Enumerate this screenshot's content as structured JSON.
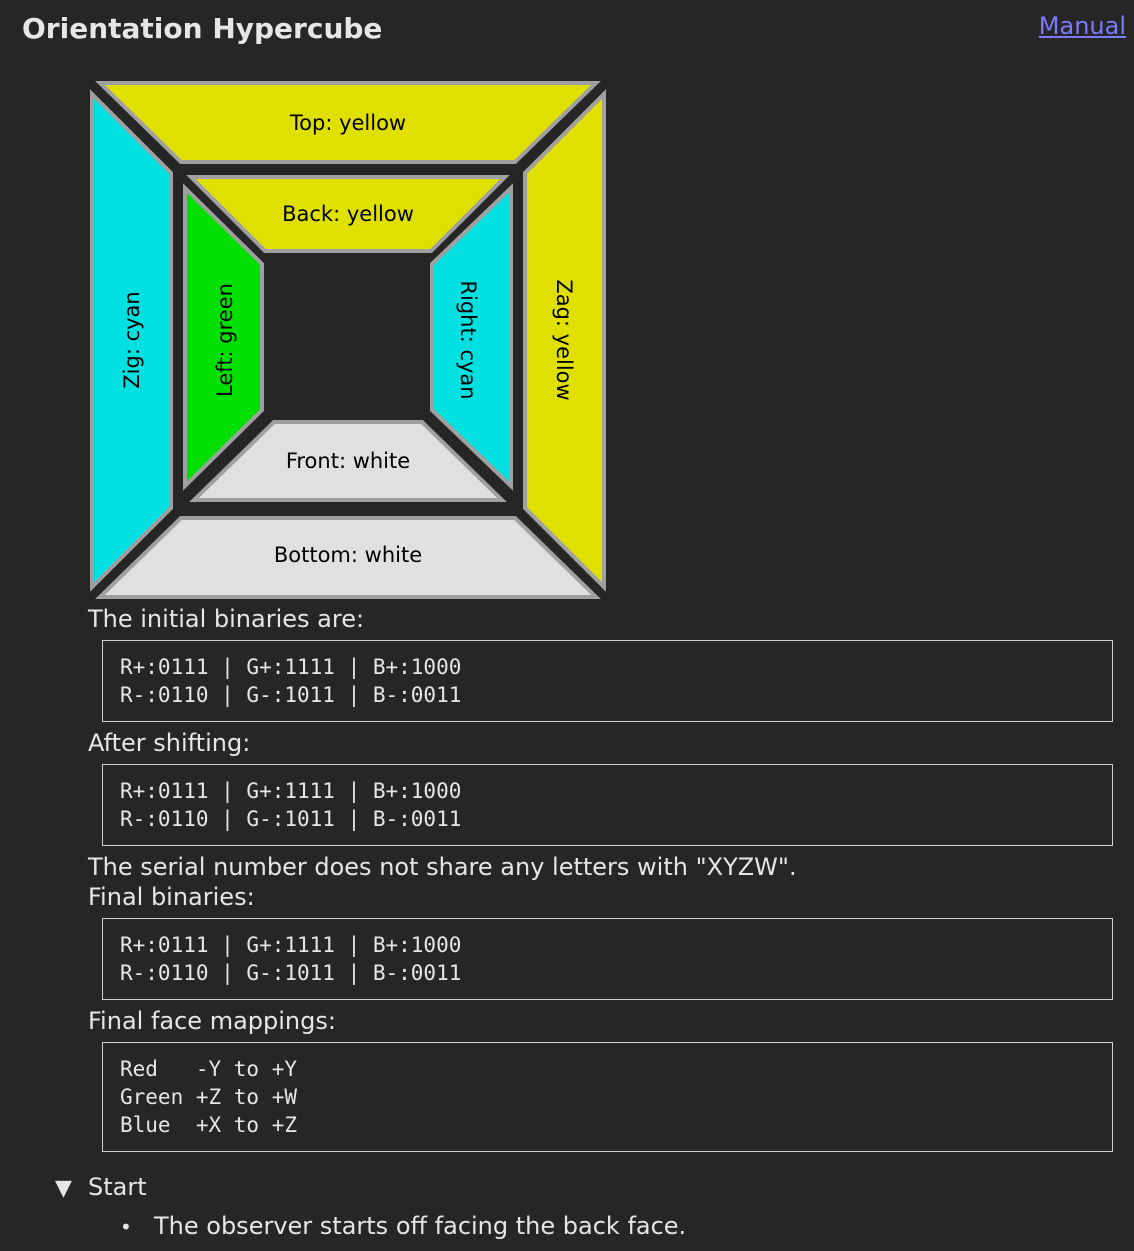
{
  "page": {
    "title": "Orientation Hypercube",
    "manual_link": "Manual"
  },
  "diagram": {
    "faces": {
      "top": "Top: yellow",
      "back": "Back: yellow",
      "zig": "Zig: cyan",
      "left": "Left: green",
      "right": "Right: cyan",
      "zag": "Zag: yellow",
      "front": "Front: white",
      "bottom": "Bottom: white"
    },
    "colors": {
      "yellow": "#e0e000",
      "cyan": "#00e0e0",
      "green": "#00e000",
      "white": "#e0e0e0",
      "border": "#a0a0a0",
      "gap": "#262626"
    }
  },
  "sections": {
    "initial_label": "The initial binaries are:",
    "initial_code": "R+:0111 | G+:1111 | B+:1000\nR-:0110 | G-:1011 | B-:0011",
    "shift_label": "After shifting:",
    "shift_code": "R+:0111 | G+:1111 | B+:1000\nR-:0110 | G-:1011 | B-:0011",
    "serial_note": "The serial number does not share any letters with \"XYZW\".",
    "final_label": "Final binaries:",
    "final_code": "R+:0111 | G+:1111 | B+:1000\nR-:0110 | G-:1011 | B-:0011",
    "mapping_label": "Final face mappings:",
    "mapping_code": "Red   -Y to +Y\nGreen +Z to +W\nBlue  +X to +Z"
  },
  "start": {
    "summary": "Start",
    "triangle": "▼",
    "bullet": "•",
    "items": [
      "The observer starts off facing the back face."
    ]
  }
}
